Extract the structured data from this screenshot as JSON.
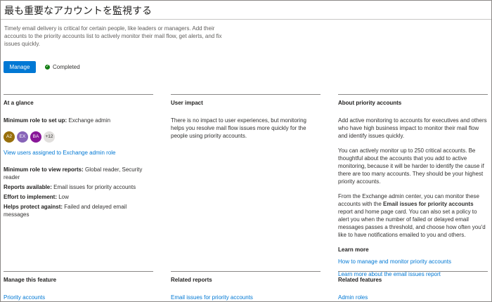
{
  "page": {
    "title": "最も重要なアカウントを監視する",
    "description": "Timely email delivery is critical for certain people, like leaders or managers. Add their accounts to the priority accounts list to actively monitor their mail flow, get alerts, and fix issues quickly.",
    "manage_label": "Manage",
    "status_label": "Completed"
  },
  "at_a_glance": {
    "heading": "At a glance",
    "min_role_setup_label": "Minimum role to set up:",
    "min_role_setup_value": "Exchange admin",
    "avatars": [
      {
        "initials": "A2",
        "color": "#986f0b"
      },
      {
        "initials": "EX",
        "color": "#8764b8"
      },
      {
        "initials": "BA",
        "color": "#881798"
      }
    ],
    "avatar_more": "+12",
    "view_users_link": "View users assigned to Exchange admin role",
    "min_role_reports_label": "Minimum role to view reports:",
    "min_role_reports_value": "Global reader, Security reader",
    "reports_available_label": "Reports available:",
    "reports_available_value": "Email issues for priority accounts",
    "effort_label": "Effort to implement:",
    "effort_value": "Low",
    "protect_label": "Helps protect against:",
    "protect_value": "Failed and delayed email messages"
  },
  "user_impact": {
    "heading": "User impact",
    "text": "There is no impact to user experiences, but monitoring helps you resolve mail flow issues more quickly for the people using priority accounts."
  },
  "about": {
    "heading": "About priority accounts",
    "p1": "Add active monitoring to accounts for executives and others who have high business impact to monitor their mail flow and identify issues quickly.",
    "p2": "You can actively monitor up to 250 critical accounts. Be thoughtful about the accounts that you add to active monitoring, because it will be harder to identify the cause if there are too many accounts. They should be your highest priority accounts.",
    "p3_before": "From the Exchange admin center, you can monitor these accounts with the ",
    "p3_bold": "Email issues for priority accounts",
    "p3_after": " report and home page card. You can also set a policy to alert you when the number of failed or delayed email messages passes a threshold, and choose how often you'd like to have notifications emailed to you and others.",
    "learn_more": "Learn more",
    "link1": "How to manage and monitor priority accounts",
    "link2": "Learn more about the email issues report"
  },
  "footer": {
    "manage": {
      "heading": "Manage this feature",
      "link": "Priority accounts"
    },
    "reports": {
      "heading": "Related reports",
      "link": "Email issues for priority accounts"
    },
    "features": {
      "heading": "Related features",
      "link": "Admin roles"
    }
  }
}
